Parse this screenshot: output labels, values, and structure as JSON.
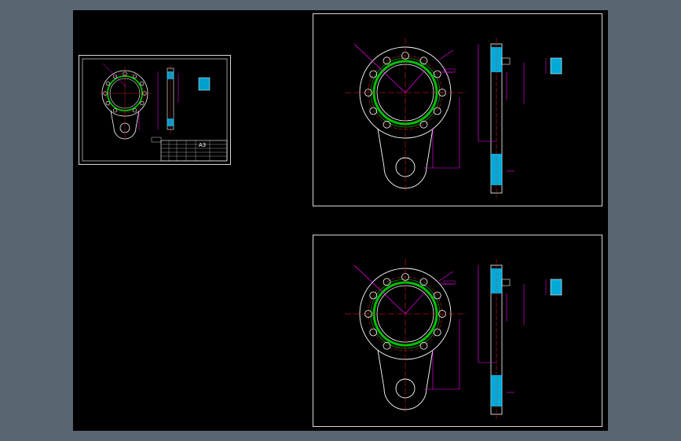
{
  "viewer": {
    "background_color": "#5a6572",
    "canvas_color": "#000000"
  },
  "colors": {
    "outline": "#ffffff",
    "center_line": "#ff2020",
    "dimension": "#ff00ff",
    "seal_ring": "#00c000",
    "hatch": "#00c8ff",
    "hidden": "#ffff00"
  },
  "title_block": {
    "sheet_size": "A3"
  }
}
